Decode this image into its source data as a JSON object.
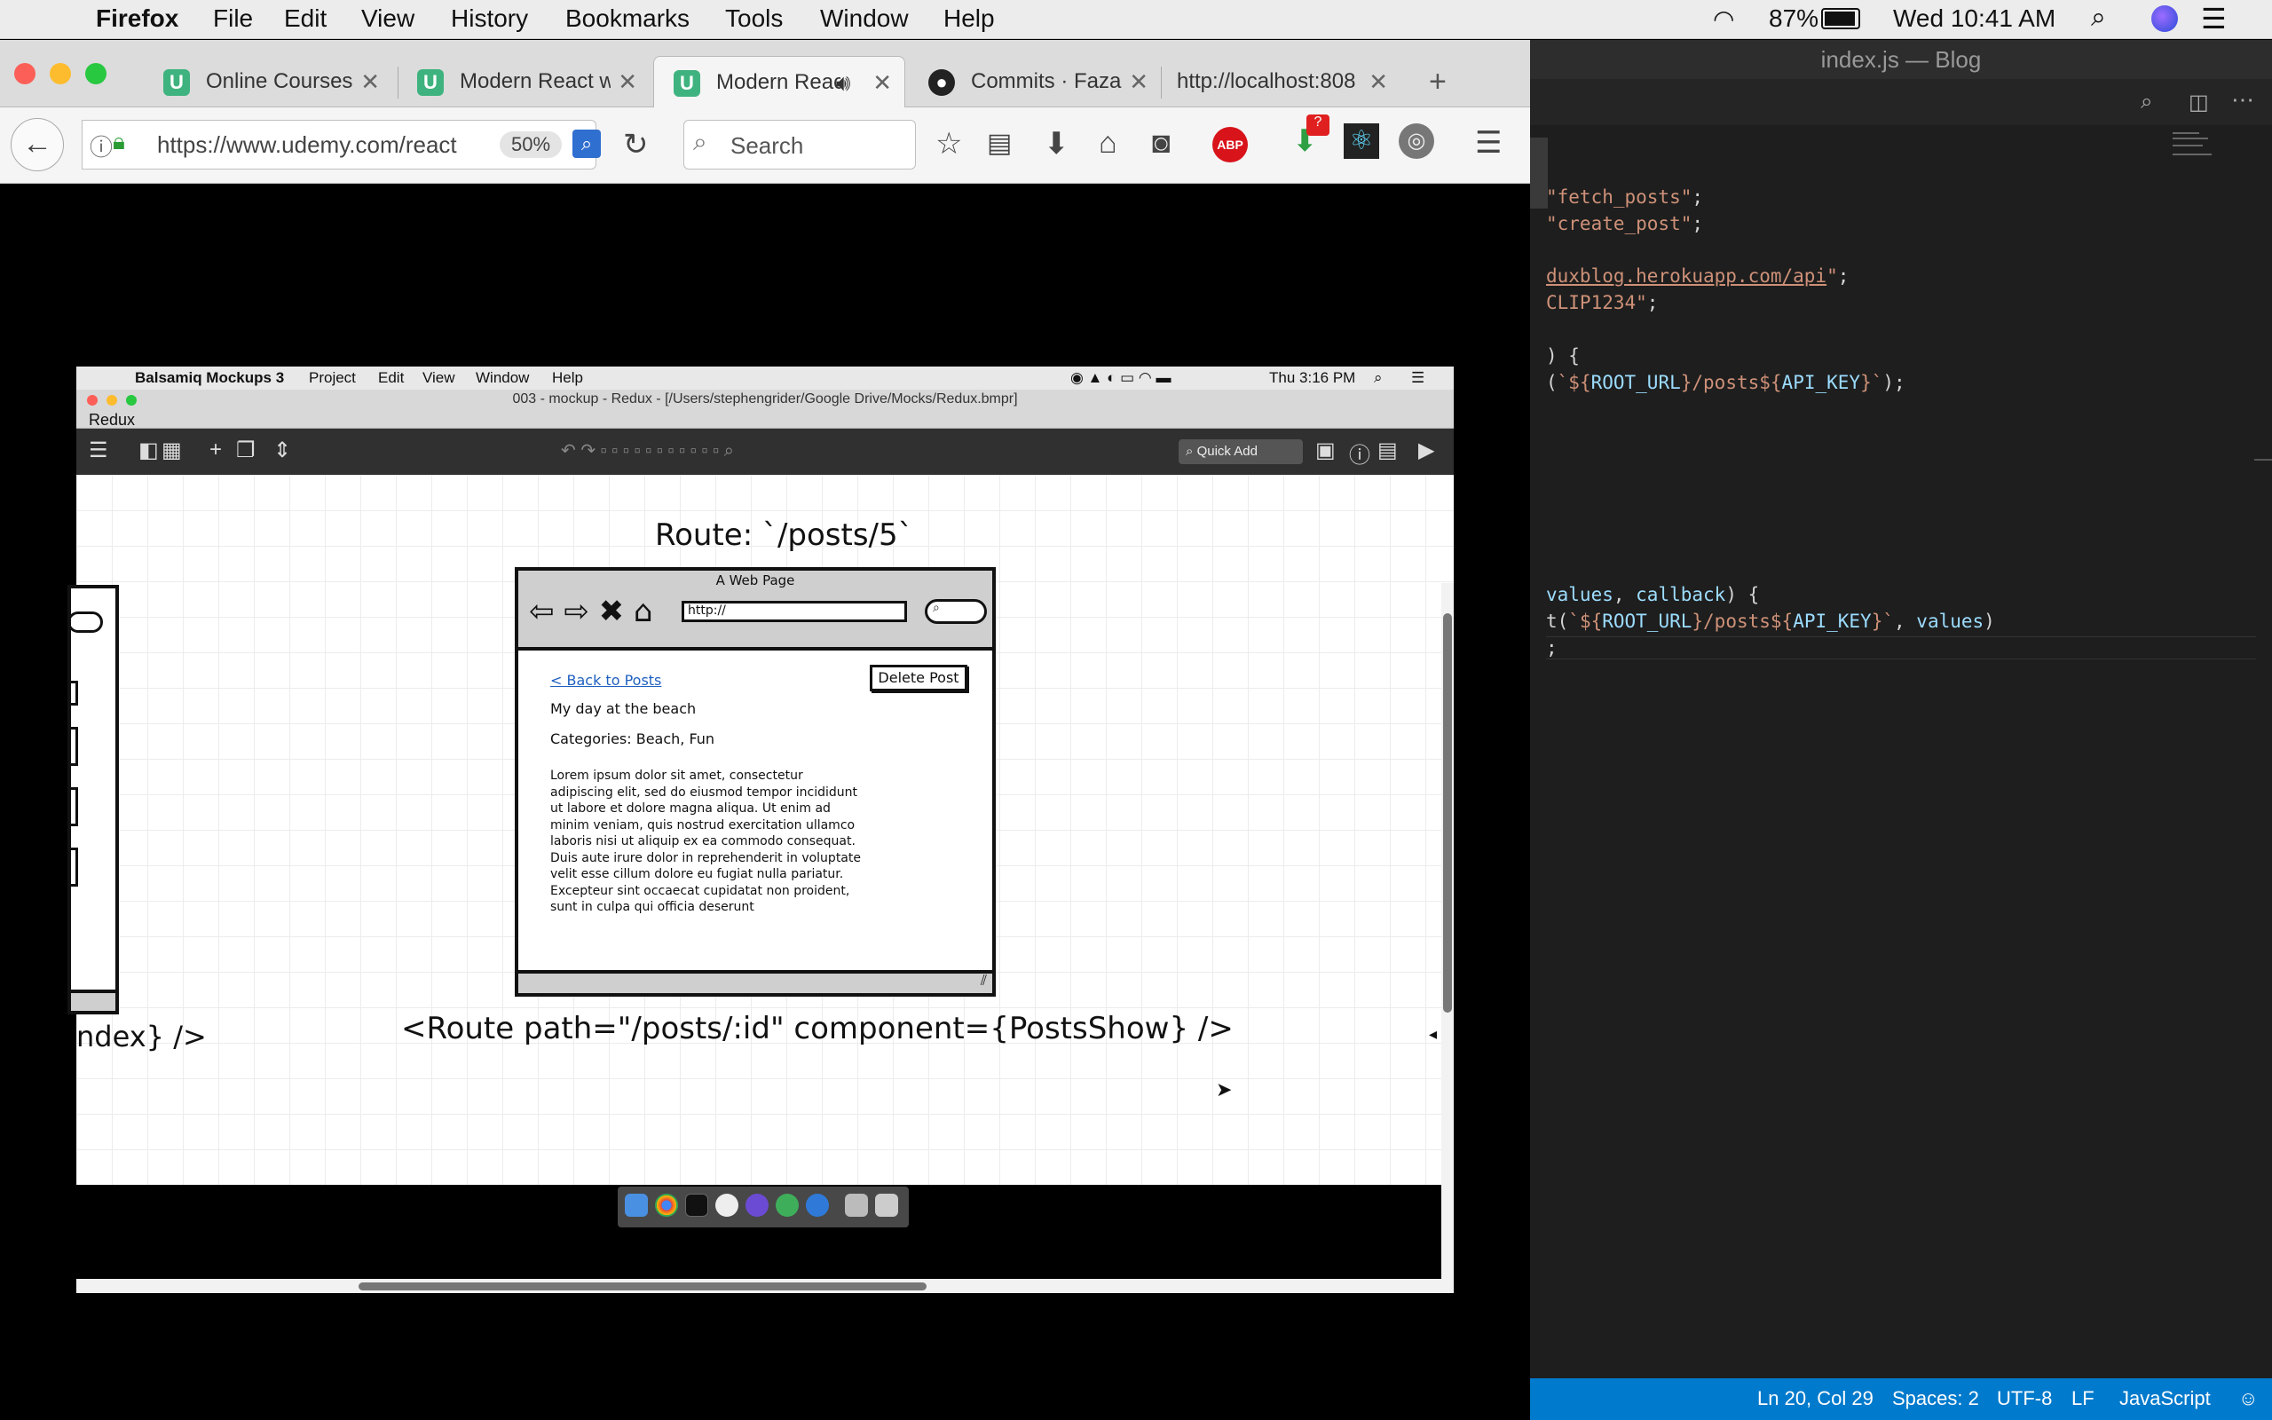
{
  "menubar": {
    "app": "Firefox",
    "items": [
      "File",
      "Edit",
      "View",
      "History",
      "Bookmarks",
      "Tools",
      "Window",
      "Help"
    ],
    "battery": "87%",
    "clock": "Wed 10:41 AM"
  },
  "firefox": {
    "tabs": [
      {
        "label": "Online Courses -",
        "close": "✕"
      },
      {
        "label": "Modern React w",
        "close": "✕"
      },
      {
        "label": "Modern Reac",
        "close": "✕"
      },
      {
        "label": "Commits · FazaC",
        "close": "✕"
      },
      {
        "label": "http://localhost:808",
        "close": "✕"
      }
    ],
    "new_tab": "+",
    "url": "https://www.udemy.com/react",
    "zoom": "50%",
    "search_placeholder": "Search",
    "abp": "ABP",
    "badge": "?"
  },
  "balsamiq": {
    "menu": [
      "Balsamiq Mockups 3",
      "Project",
      "Edit",
      "View",
      "Window",
      "Help"
    ],
    "clock": "Thu 3:16 PM",
    "window_title": "003 - mockup - Redux - [/Users/stephengrider/Google Drive/Mocks/Redux.bmpr]",
    "project": "Redux",
    "quick_add": "Quick Add",
    "route_title": "Route: `/posts/5`",
    "webpage_title": "A Web Page",
    "webpage_url": "http://",
    "back_link": "< Back to Posts",
    "delete_button": "Delete Post",
    "post_title": "My day at the beach",
    "categories": "Categories: Beach, Fun",
    "lorem": "Lorem ipsum dolor sit amet, consectetur adipiscing elit, sed do eiusmod tempor incididunt ut labore et dolore magna aliqua. Ut enim ad minim veniam, quis nostrud exercitation ullamco laboris nisi ut aliquip ex ea commodo consequat. Duis aute irure dolor in reprehenderit in voluptate velit esse cillum dolore eu fugiat nulla pariatur. Excepteur sint occaecat cupidatat non proident, sunt in culpa qui officia deserunt",
    "route_code": "<Route path=\"/posts/:id\" component={PostsShow} />",
    "left_code": "ndex} />"
  },
  "vscode": {
    "title": "index.js — Blog",
    "status": {
      "position": "Ln 20, Col 29",
      "spaces": "Spaces: 2",
      "encoding": "UTF-8",
      "eol": "LF",
      "language": "JavaScript"
    }
  }
}
